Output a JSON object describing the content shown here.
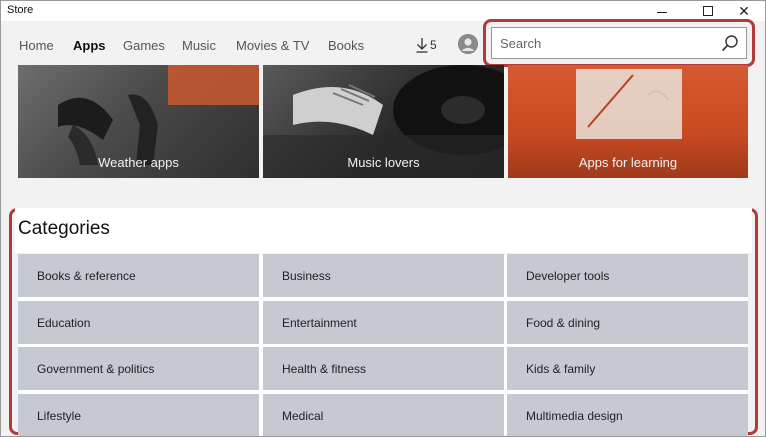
{
  "window": {
    "title": "Store"
  },
  "nav": {
    "items": [
      "Home",
      "Apps",
      "Games",
      "Music",
      "Movies & TV",
      "Books"
    ],
    "active": "Apps",
    "downloads_count": "5"
  },
  "search": {
    "placeholder": "Search"
  },
  "tiles": [
    "Weather apps",
    "Music lovers",
    "Apps for learning"
  ],
  "categories": {
    "title": "Categories",
    "items": [
      "Books & reference",
      "Business",
      "Developer tools",
      "Education",
      "Entertainment",
      "Food & dining",
      "Government & politics",
      "Health & fitness",
      "Kids & family",
      "Lifestyle",
      "Medical",
      "Multimedia design"
    ]
  },
  "colors": {
    "highlight": "#b23a3a",
    "category_bg": "#c6c8d2"
  },
  "icons": [
    "minimize-icon",
    "maximize-icon",
    "close-icon",
    "download-icon",
    "account-icon",
    "search-icon"
  ]
}
